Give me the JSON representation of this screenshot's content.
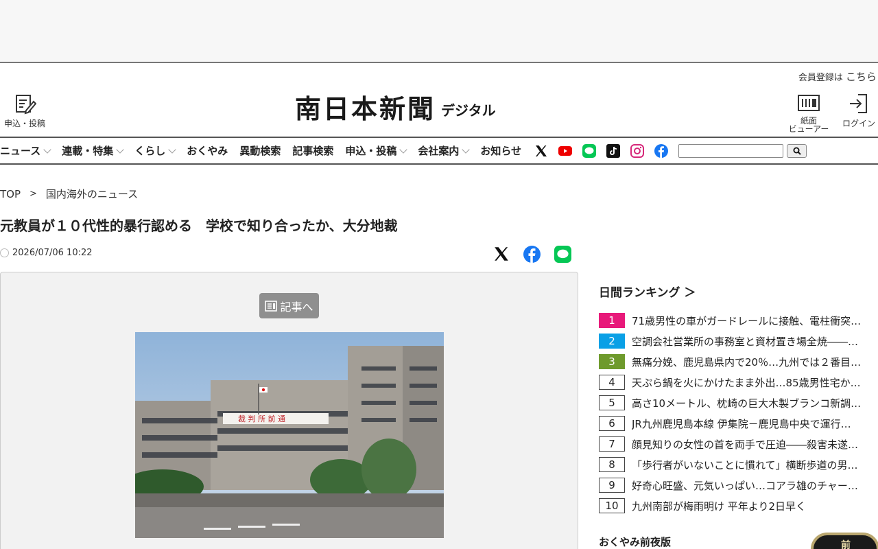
{
  "header": {
    "member_text": "会員登録は",
    "member_link": "こちら",
    "apply_label": "申込・投稿",
    "logo": "南日本新聞",
    "logo_sub": "デジタル",
    "viewer_label_1": "紙面",
    "viewer_label_2": "ビューアー",
    "login_label": "ログイン"
  },
  "nav": {
    "items": [
      {
        "label": "ニュース",
        "dropdown": true
      },
      {
        "label": "連載・特集",
        "dropdown": true
      },
      {
        "label": "くらし",
        "dropdown": true
      },
      {
        "label": "おくやみ",
        "dropdown": false
      },
      {
        "label": "異動検索",
        "dropdown": false
      },
      {
        "label": "記事検索",
        "dropdown": false
      },
      {
        "label": "申込・投稿",
        "dropdown": true
      },
      {
        "label": "会社案内",
        "dropdown": true
      },
      {
        "label": "お知らせ",
        "dropdown": false
      }
    ],
    "social_icons": [
      "x-icon",
      "youtube-icon",
      "line-icon",
      "tiktok-icon",
      "instagram-icon",
      "facebook-icon"
    ],
    "search_placeholder": ""
  },
  "breadcrumb": {
    "top": "TOP",
    "sep": ">",
    "current": "国内海外のニュース"
  },
  "article": {
    "title": "元教員が１０代性的暴行認める　学校で知り合ったか、大分地裁",
    "date": "2026/07/06 10:22",
    "to_article_label": "記事へ",
    "photo_banner": "裁 判 所 前 通"
  },
  "ranking": {
    "title": "日間ランキング ＞",
    "items": [
      {
        "rank": "1",
        "text": "71歳男性の車がガードレールに接触、電柱衝突…",
        "color": "#e8197a"
      },
      {
        "rank": "2",
        "text": "空調会社営業所の事務室と資材置き場全焼――…",
        "color": "#0aa0e6"
      },
      {
        "rank": "3",
        "text": "無痛分娩、鹿児島県内で20％…九州では２番目…",
        "color": "#6e9a2c"
      },
      {
        "rank": "4",
        "text": "天ぷら鍋を火にかけたまま外出…85歳男性宅か…",
        "color": ""
      },
      {
        "rank": "5",
        "text": "高さ10メートル、枕崎の巨大木製ブランコ新調…",
        "color": ""
      },
      {
        "rank": "6",
        "text": "JR九州鹿児島本線 伊集院－鹿児島中央で運行…",
        "color": ""
      },
      {
        "rank": "7",
        "text": "顔見知りの女性の首を両手で圧迫――殺害未遂…",
        "color": ""
      },
      {
        "rank": "8",
        "text": "「歩行者がいないことに慣れて」横断歩道の男…",
        "color": ""
      },
      {
        "rank": "9",
        "text": "好奇心旺盛、元気いっぱい…コアラ雄のチャー…",
        "color": ""
      },
      {
        "rank": "10",
        "text": "九州南部が梅雨明け 平年より2日早く",
        "color": ""
      }
    ]
  },
  "okuyami": {
    "title": "おくやみ前夜版",
    "badge_char": "前"
  }
}
